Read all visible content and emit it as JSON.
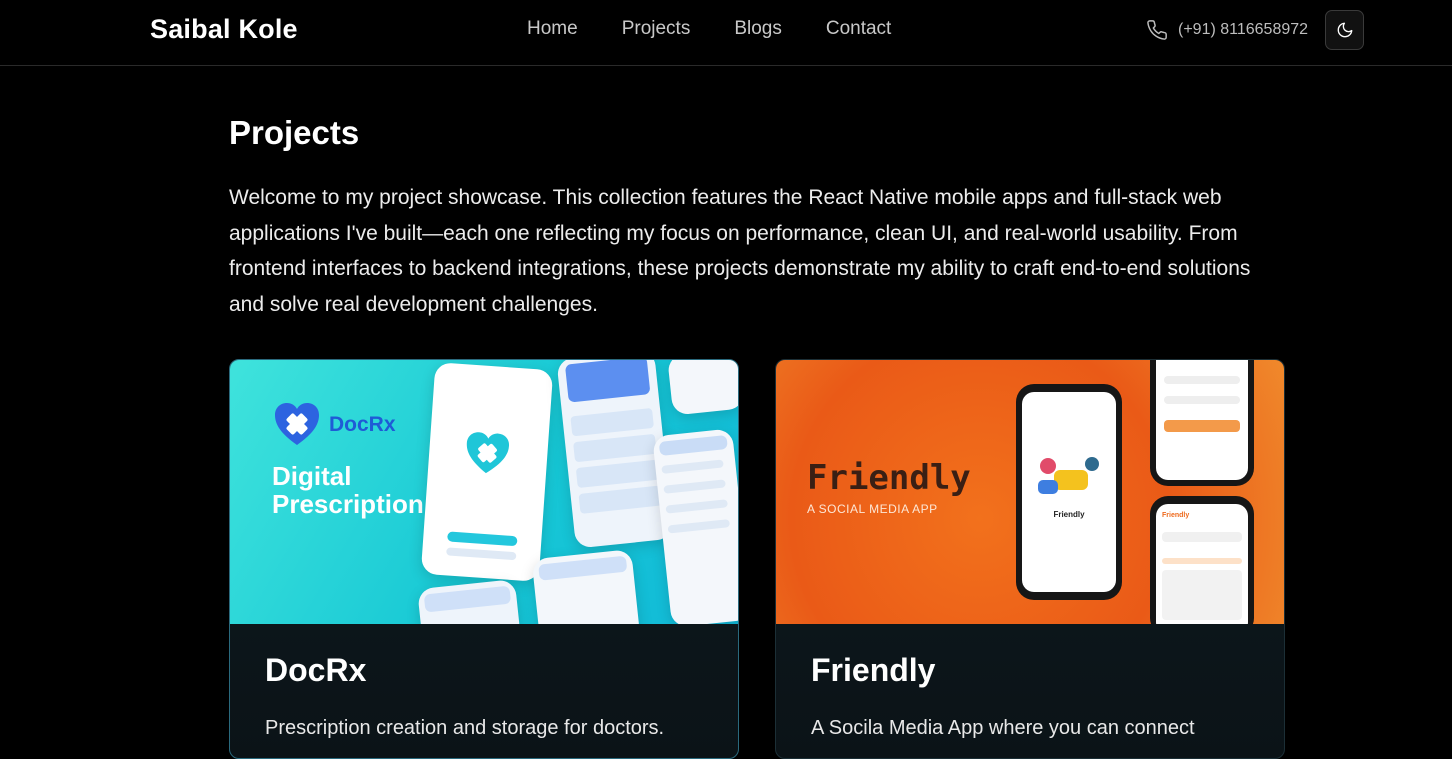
{
  "brand": "Saibal Kole",
  "nav": [
    "Home",
    "Projects",
    "Blogs",
    "Contact"
  ],
  "contact": {
    "phone": "(+91) 8116658972"
  },
  "theme_toggle": "moon-icon",
  "page": {
    "title": "Projects",
    "intro": "Welcome to my project showcase. This collection features the React Native mobile apps and full-stack web applications I've built—each one reflecting my focus on performance, clean UI, and real-world usability. From frontend interfaces to backend integrations, these projects demonstrate my ability to craft end-to-end solutions and solve real development challenges."
  },
  "projects": [
    {
      "title": "DocRx",
      "description": "Prescription creation and storage for doctors.",
      "thumb": {
        "logo_text": "DocRx",
        "headline_1": "Digital",
        "headline_2": "Prescription"
      }
    },
    {
      "title": "Friendly",
      "description": "A Socila Media App where you can connect",
      "thumb": {
        "logo_text": "Friendly",
        "subtitle": "A SOCIAL MEDIA APP"
      }
    }
  ],
  "colors": {
    "background": "#000000",
    "docrx_accent": "#1fd3d8",
    "friendly_accent": "#ee6a1d"
  }
}
